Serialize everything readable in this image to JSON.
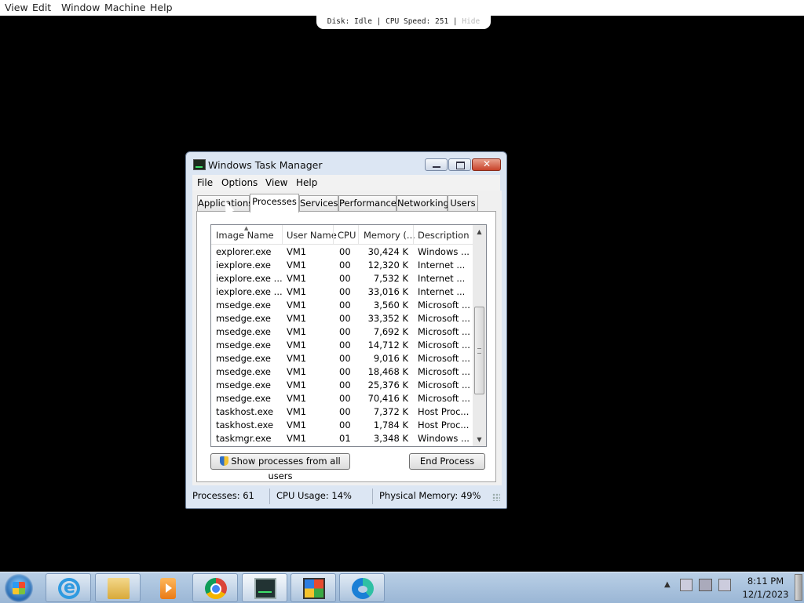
{
  "host_menu": [
    "View",
    "Edit",
    "Window",
    "Machine",
    "Help"
  ],
  "vm_status": {
    "disk": "Disk: Idle",
    "cpu": "CPU Speed: 251",
    "hide": "Hide"
  },
  "window": {
    "title": "Windows Task Manager",
    "close_glyph": "✕",
    "menu": [
      "File",
      "Options",
      "View",
      "Help"
    ],
    "tabs": [
      "Applications",
      "Processes",
      "Services",
      "Performance",
      "Networking",
      "Users"
    ],
    "active_tab": "Processes",
    "columns": [
      "Image Name",
      "User Name",
      "CPU",
      "Memory (...",
      "Description"
    ],
    "rows": [
      [
        "explorer.exe",
        "VM1",
        "00",
        "30,424 K",
        "Windows ..."
      ],
      [
        "iexplore.exe",
        "VM1",
        "00",
        "12,320 K",
        "Internet ..."
      ],
      [
        "iexplore.exe ...",
        "VM1",
        "00",
        "7,532 K",
        "Internet ..."
      ],
      [
        "iexplore.exe ...",
        "VM1",
        "00",
        "33,016 K",
        "Internet ..."
      ],
      [
        "msedge.exe",
        "VM1",
        "00",
        "3,560 K",
        "Microsoft ..."
      ],
      [
        "msedge.exe",
        "VM1",
        "00",
        "33,352 K",
        "Microsoft ..."
      ],
      [
        "msedge.exe",
        "VM1",
        "00",
        "7,692 K",
        "Microsoft ..."
      ],
      [
        "msedge.exe",
        "VM1",
        "00",
        "14,712 K",
        "Microsoft ..."
      ],
      [
        "msedge.exe",
        "VM1",
        "00",
        "9,016 K",
        "Microsoft ..."
      ],
      [
        "msedge.exe",
        "VM1",
        "00",
        "18,468 K",
        "Microsoft ..."
      ],
      [
        "msedge.exe",
        "VM1",
        "00",
        "25,376 K",
        "Microsoft ..."
      ],
      [
        "msedge.exe",
        "VM1",
        "00",
        "70,416 K",
        "Microsoft ..."
      ],
      [
        "taskhost.exe",
        "VM1",
        "00",
        "7,372 K",
        "Host Proc..."
      ],
      [
        "taskhost.exe",
        "VM1",
        "00",
        "1,784 K",
        "Host Proc..."
      ],
      [
        "taskmgr.exe",
        "VM1",
        "01",
        "3,348 K",
        "Windows ..."
      ]
    ],
    "show_all_label": "Show processes from all users",
    "end_process_label": "End Process",
    "status": {
      "processes": "Processes: 61",
      "cpu": "CPU Usage: 14%",
      "memory": "Physical Memory: 49%"
    }
  },
  "taskbar": {
    "icons": [
      "internet-explorer-icon",
      "file-explorer-icon",
      "media-player-icon",
      "chrome-icon",
      "task-manager-icon",
      "windows-icon",
      "edge-icon"
    ],
    "tray_arrow": "▲",
    "time": "8:11 PM",
    "date": "12/1/2023"
  }
}
